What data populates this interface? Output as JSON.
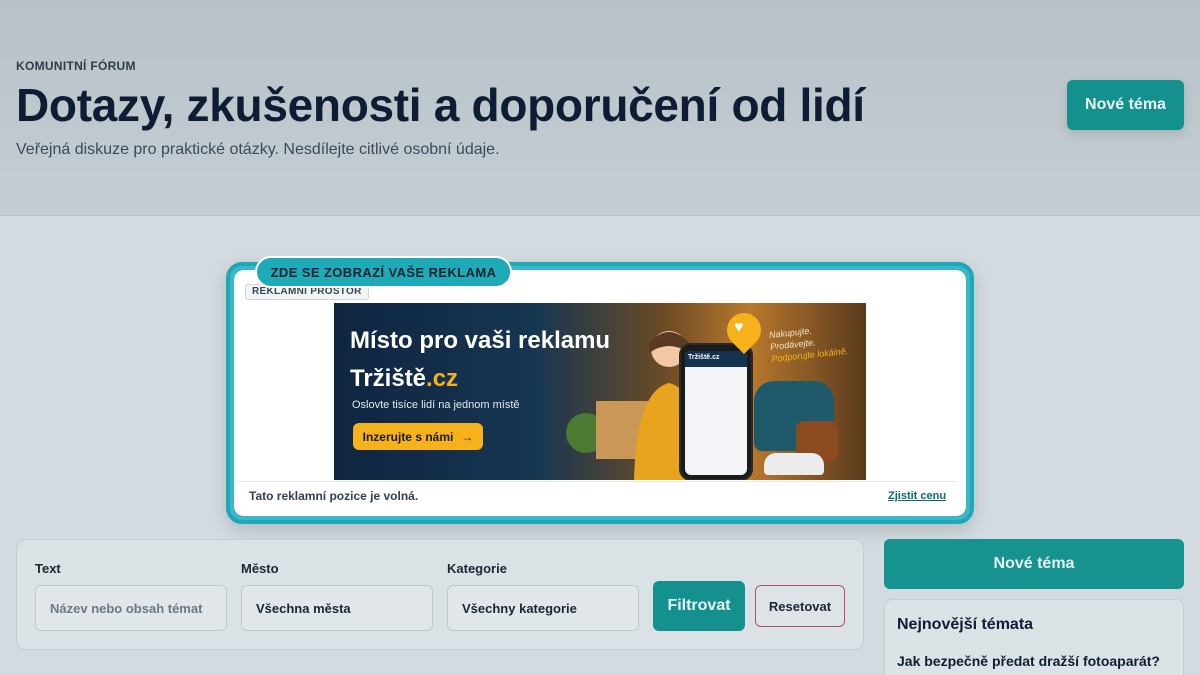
{
  "header": {
    "eyebrow": "KOMUNITNÍ FÓRUM",
    "title": "Dotazy, zkušenosti a doporučení od lidí",
    "subtitle": "Veřejná diskuze pro praktické otázky. Nesdílejte citlivé osobní údaje.",
    "new_topic_label": "Nové téma"
  },
  "ad": {
    "pill_label": "ZDE SE ZOBRAZÍ VAŠE REKLAMA",
    "tag_label": "REKLAMNÍ PROSTOR",
    "banner": {
      "headline": "Místo pro vaši reklamu",
      "brand_name": "Tržiště",
      "brand_tld": ".cz",
      "subline": "Oslovte tisíce lidí na jednom místě",
      "cta_label": "Inzerujte s námi",
      "script_line1": "Nakupujte.",
      "script_line2": "Prodávejte.",
      "script_line3": "Podporujte lokálně.",
      "phone_brand": "Tržiště.cz"
    },
    "free_text": "Tato reklamní pozice je volná.",
    "price_link": "Zjistit cenu"
  },
  "filter": {
    "text_label": "Text",
    "text_placeholder": "Název nebo obsah témat",
    "city_label": "Město",
    "city_value": "Všechna města",
    "category_label": "Kategorie",
    "category_value": "Všechny kategorie",
    "filter_button": "Filtrovat",
    "reset_button": "Resetovat"
  },
  "sidebar": {
    "new_topic_label": "Nové téma",
    "latest_title": "Nejnovější témata",
    "latest_items": [
      "Jak bezpečně předat dražší fotoaparát?"
    ]
  },
  "colors": {
    "accent": "#14908f",
    "ad_border": "#1ea7b8",
    "cta_yellow": "#f6b21a",
    "reset_border": "#b7506e"
  }
}
